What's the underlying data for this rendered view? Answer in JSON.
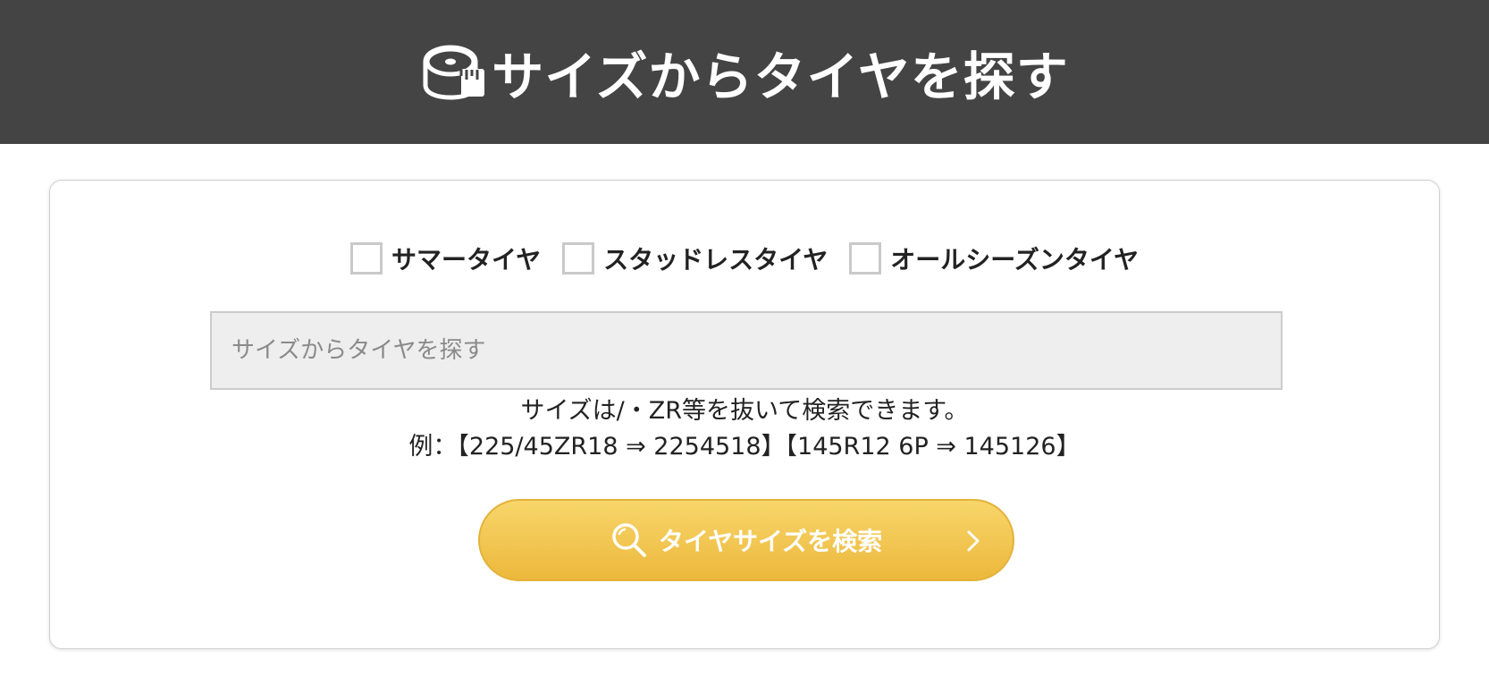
{
  "header": {
    "icon": "tape-measure-icon",
    "title": "サイズからタイヤを探す"
  },
  "filters": {
    "options": [
      {
        "label": "サマータイヤ",
        "checked": false
      },
      {
        "label": "スタッドレスタイヤ",
        "checked": false
      },
      {
        "label": "オールシーズンタイヤ",
        "checked": false
      }
    ]
  },
  "search": {
    "placeholder": "サイズからタイヤを探す",
    "value": ""
  },
  "hint": {
    "line1": "サイズは/・ZR等を抜いて検索できます。",
    "line2": "例：【225/45ZR18 ⇒ 2254518】【145R12 6P ⇒ 145126】"
  },
  "button": {
    "label": "タイヤサイズを検索",
    "icon": "search-icon",
    "chevron_icon": "chevron-right-icon"
  },
  "colors": {
    "header_bg": "#444444",
    "button_top": "#f8d66b",
    "button_bottom": "#ecb83c",
    "input_bg": "#eeeeee"
  }
}
